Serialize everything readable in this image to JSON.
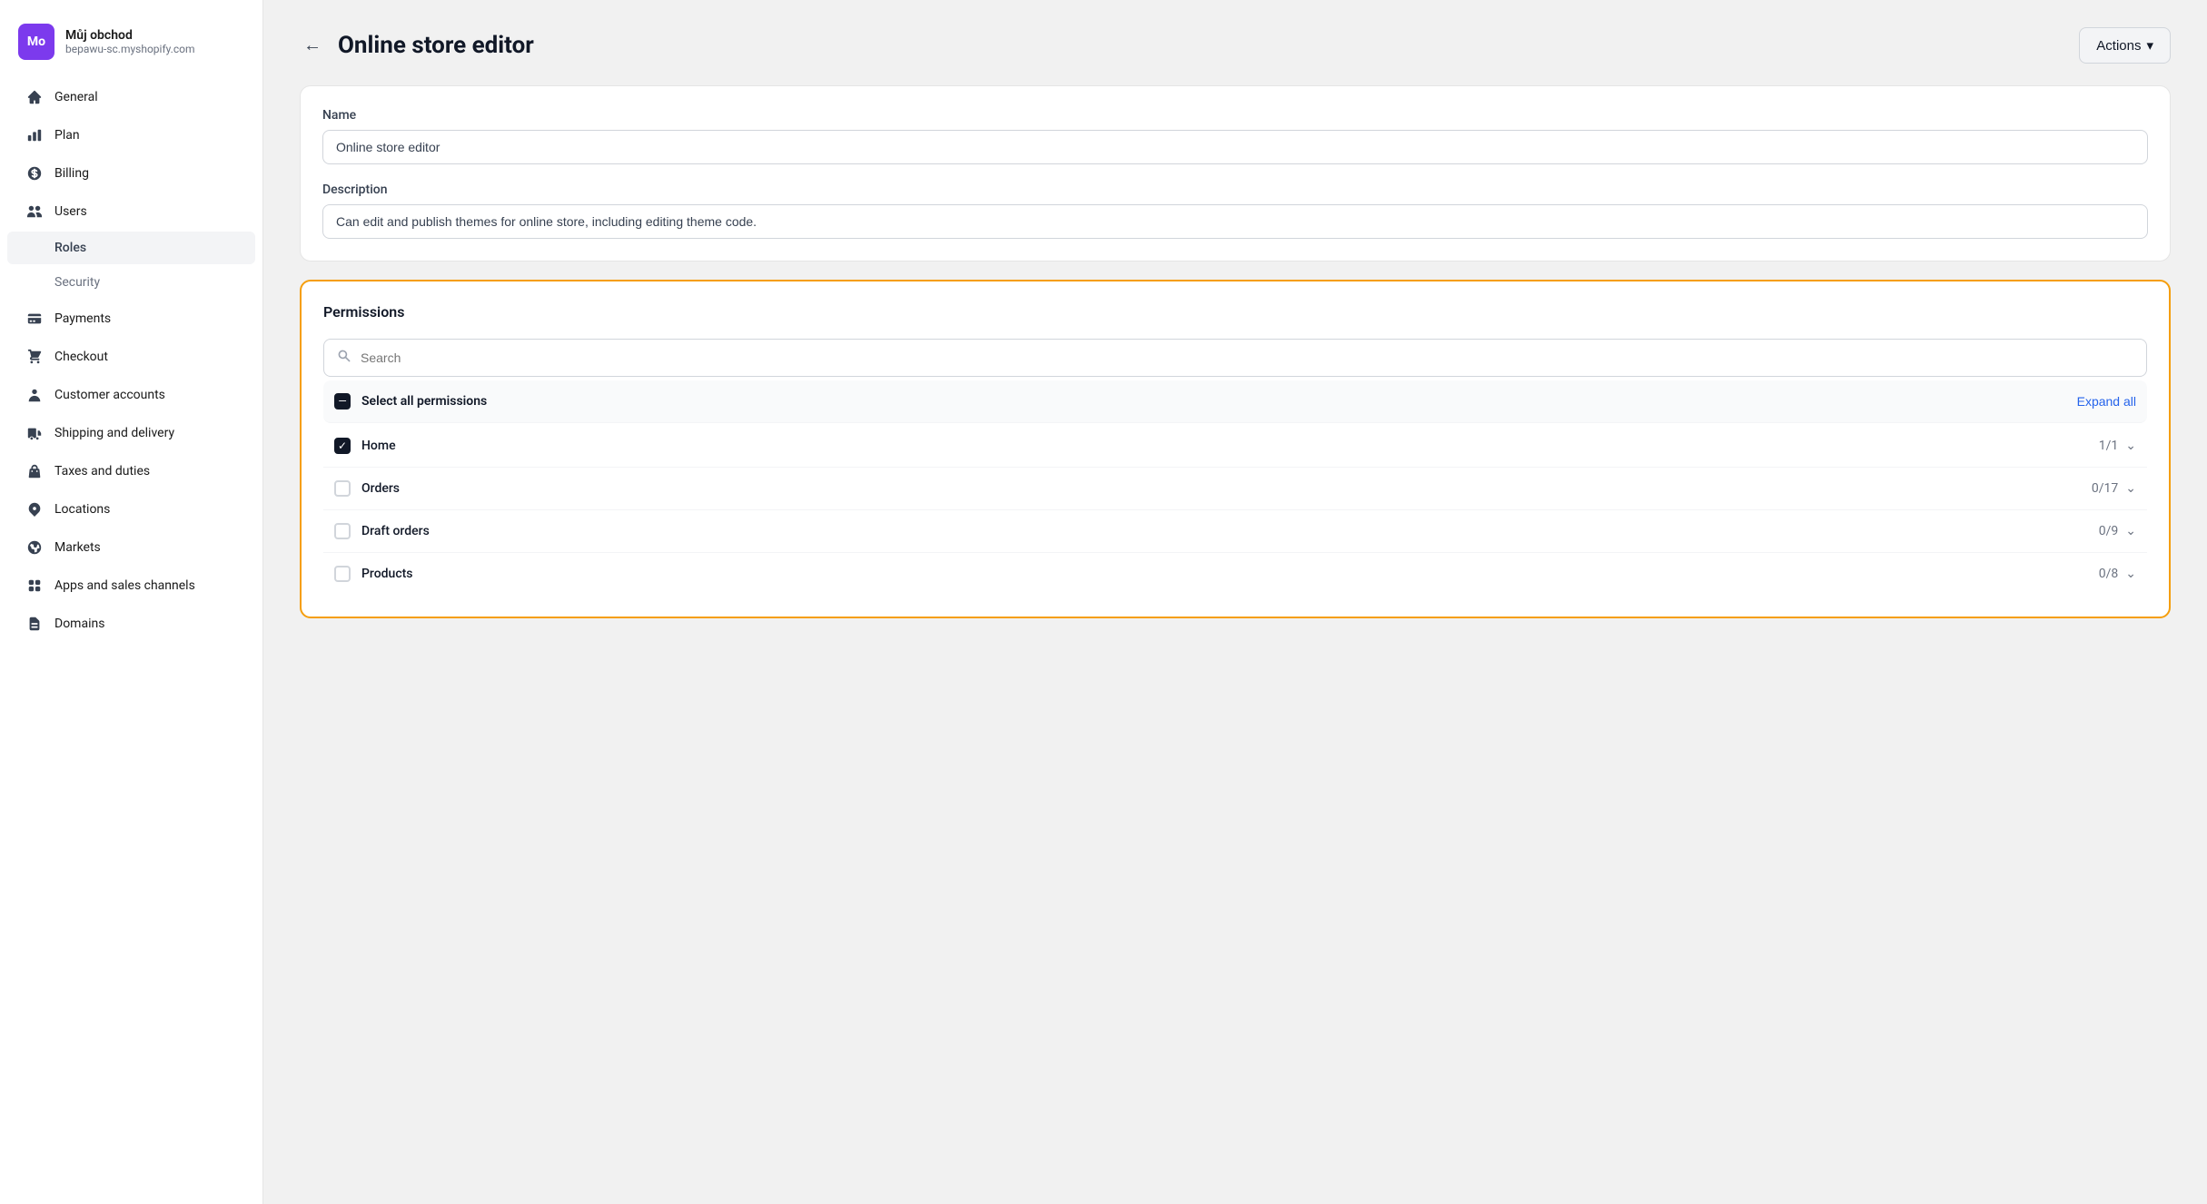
{
  "store": {
    "initials": "Mo",
    "name": "Můj obchod",
    "url": "bepawu-sc.myshopify.com"
  },
  "nav": {
    "items": [
      {
        "id": "general",
        "label": "General",
        "icon": "home"
      },
      {
        "id": "plan",
        "label": "Plan",
        "icon": "chart"
      },
      {
        "id": "billing",
        "label": "Billing",
        "icon": "dollar"
      },
      {
        "id": "users",
        "label": "Users",
        "icon": "users"
      },
      {
        "id": "roles",
        "label": "Roles",
        "sub": true,
        "active": true
      },
      {
        "id": "security",
        "label": "Security",
        "sub": true,
        "secondary": true
      },
      {
        "id": "payments",
        "label": "Payments",
        "icon": "payments"
      },
      {
        "id": "checkout",
        "label": "Checkout",
        "icon": "cart"
      },
      {
        "id": "customer-accounts",
        "label": "Customer accounts",
        "icon": "person"
      },
      {
        "id": "shipping",
        "label": "Shipping and delivery",
        "icon": "truck"
      },
      {
        "id": "taxes",
        "label": "Taxes and duties",
        "icon": "tax"
      },
      {
        "id": "locations",
        "label": "Locations",
        "icon": "location"
      },
      {
        "id": "markets",
        "label": "Markets",
        "icon": "globe"
      },
      {
        "id": "apps",
        "label": "Apps and sales channels",
        "icon": "apps"
      },
      {
        "id": "domains",
        "label": "Domains",
        "icon": "domains"
      }
    ]
  },
  "header": {
    "title": "Online store editor",
    "back_label": "←",
    "actions_label": "Actions",
    "chevron": "▾"
  },
  "form": {
    "name_label": "Name",
    "name_value": "Online store editor",
    "description_label": "Description",
    "description_value": "Can edit and publish themes for online store, including editing theme code."
  },
  "permissions": {
    "title": "Permissions",
    "search_placeholder": "Search",
    "expand_all_label": "Expand all",
    "select_all_label": "Select all permissions",
    "items": [
      {
        "id": "home",
        "label": "Home",
        "count": "1/1",
        "checked": true,
        "indeterminate": false
      },
      {
        "id": "orders",
        "label": "Orders",
        "count": "0/17",
        "checked": false,
        "indeterminate": false
      },
      {
        "id": "draft-orders",
        "label": "Draft orders",
        "count": "0/9",
        "checked": false,
        "indeterminate": false
      },
      {
        "id": "products",
        "label": "Products",
        "count": "0/8",
        "checked": false,
        "indeterminate": false
      }
    ]
  }
}
